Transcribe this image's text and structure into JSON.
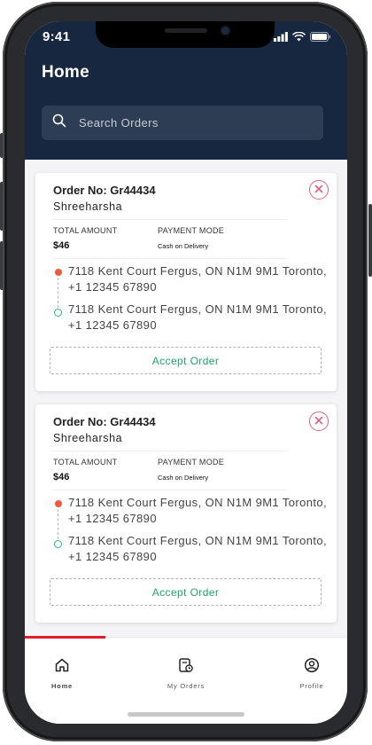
{
  "status_bar": {
    "time": "9:41"
  },
  "header": {
    "title": "Home"
  },
  "search": {
    "placeholder": "Search Orders"
  },
  "orders": [
    {
      "order_no": "Order No: Gr44434",
      "customer": "Shreeharsha",
      "total_label": "TOTAL AMOUNT",
      "total_value": "$46",
      "payment_label": "PAYMENT MODE",
      "payment_value": "Cash on Delivery",
      "pickup": "7118 Kent Court Fergus, ON N1M 9M1 Toronto, +1 12345 67890",
      "dropoff": "7118 Kent Court Fergus, ON N1M 9M1 Toronto, +1 12345 67890",
      "accept_label": "Accept Order"
    },
    {
      "order_no": "Order No: Gr44434",
      "customer": "Shreeharsha",
      "total_label": "TOTAL AMOUNT",
      "total_value": "$46",
      "payment_label": "PAYMENT MODE",
      "payment_value": "Cash on Delivery",
      "pickup": "7118 Kent Court Fergus, ON N1M 9M1 Toronto, +1 12345 67890",
      "dropoff": "7118 Kent Court Fergus, ON N1M 9M1 Toronto, +1 12345 67890",
      "accept_label": "Accept Order"
    }
  ],
  "tabs": [
    {
      "label": "Home",
      "icon": "home-icon",
      "active": true
    },
    {
      "label": "My Orders",
      "icon": "orders-icon",
      "active": false
    },
    {
      "label": "Profile",
      "icon": "profile-icon",
      "active": false
    }
  ],
  "colors": {
    "header_bg": "#17273f",
    "accept_green": "#1fa46c",
    "close_pink": "#e0607e",
    "tab_indicator": "#e21b2a",
    "pickup_dot": "#ec5a3f",
    "dropoff_dot": "#2cb389"
  }
}
